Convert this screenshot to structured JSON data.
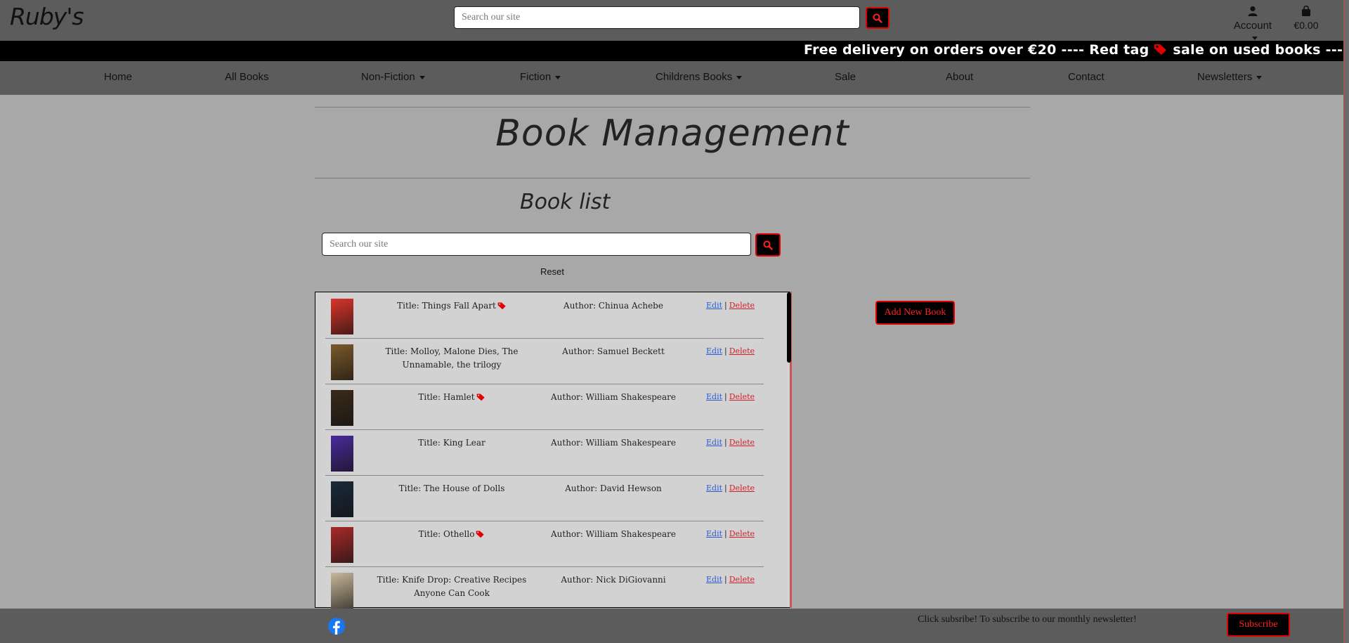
{
  "header": {
    "logo": "Ruby's",
    "search_placeholder": "Search our site",
    "account_label": "Account",
    "cart_total": "€0.00"
  },
  "marquee": {
    "part1": "Free delivery on orders over €20 ---- Red tag",
    "part2": "sale on used books ---- Free deli"
  },
  "nav": {
    "items": [
      {
        "label": "Home"
      },
      {
        "label": "All Books"
      },
      {
        "label": "Non-Fiction"
      },
      {
        "label": "Fiction"
      },
      {
        "label": "Childrens Books"
      },
      {
        "label": "Sale"
      },
      {
        "label": "About"
      },
      {
        "label": "Contact"
      },
      {
        "label": "Newsletters"
      }
    ]
  },
  "main": {
    "page_title": "Book Management",
    "list_title": "Book list",
    "search_placeholder": "Search our site",
    "reset_label": "Reset",
    "add_button_label": "Add New Book",
    "edit_label": "Edit",
    "delete_label": "Delete",
    "separator": "|"
  },
  "books": [
    {
      "title": "Title: Things Fall Apart",
      "author": "Author: Chinua Achebe",
      "sale": true,
      "cover_color": "#d9352a"
    },
    {
      "title": "Title: Molloy, Malone Dies, The Unnamable, the trilogy",
      "author": "Author: Samuel Beckett",
      "sale": false,
      "cover_color": "#7a5a2a"
    },
    {
      "title": "Title: Hamlet",
      "author": "Author: William Shakespeare",
      "sale": true,
      "cover_color": "#3a2a1a"
    },
    {
      "title": "Title: King Lear",
      "author": "Author: William Shakespeare",
      "sale": false,
      "cover_color": "#4a2a9a"
    },
    {
      "title": "Title: The House of Dolls",
      "author": "Author: David Hewson",
      "sale": false,
      "cover_color": "#1a2a3a"
    },
    {
      "title": "Title: Othello",
      "author": "Author: William Shakespeare",
      "sale": true,
      "cover_color": "#a82a2a"
    },
    {
      "title": "Title: Knife Drop: Creative Recipes Anyone Can Cook",
      "author": "Author: Nick DiGiovanni",
      "sale": false,
      "cover_color": "#c8b89a"
    }
  ],
  "footer": {
    "newsletter_text": "Click subsribe! To subscribe to our monthly newsletter!",
    "subscribe_label": "Subscribe"
  },
  "colors": {
    "accent": "#e00000",
    "header_bg": "#5c5c5c",
    "page_bg": "#a8a8a8",
    "panel_bg": "#d2d2d2"
  }
}
